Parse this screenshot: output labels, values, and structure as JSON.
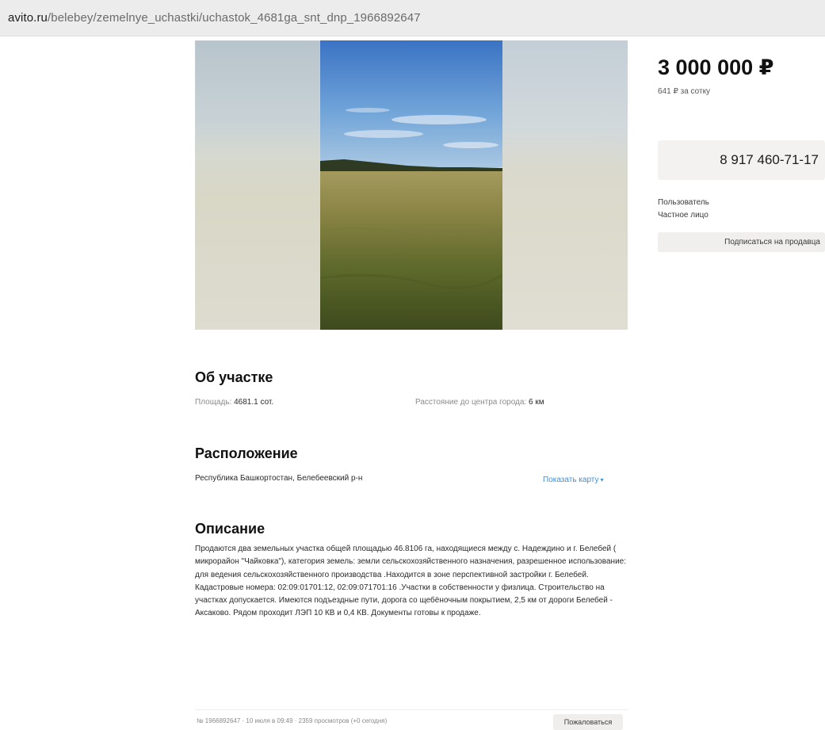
{
  "browser": {
    "url_domain": "avito.ru",
    "url_path": "/belebey/zemelnye_uchastki/uchastok_4681ga_snt_dnp_1966892647"
  },
  "listing": {
    "price": "3 000 000 ₽",
    "price_per_sotka": "641 ₽ за сотку",
    "phone": "8 917 460-71-17",
    "seller_role": "Пользователь",
    "seller_type": "Частное лицо",
    "subscribe_label": "Подписаться на продавца"
  },
  "about": {
    "title": "Об участке",
    "area_label": "Площадь:",
    "area_value": "4681.1 сот.",
    "distance_label": "Расстояние до центра города:",
    "distance_value": "6 км"
  },
  "location": {
    "title": "Расположение",
    "address": "Республика Башкортостан, Белебеевский р-н",
    "show_map_label": "Показать карту"
  },
  "description": {
    "title": "Описание",
    "text": "Продаются два земельных участка общей площадью 46.8106 га, находящиеся между с. Надеждино и г. Белебей ( микрорайон \"Чайковка\"), категория земель: земли сельскохозяйственного назначения, разрешенное использование: для ведения сельскохозяйственного производства .Находится в зоне перспективной застройки г. Белебей. Кадастровые номера: 02:09:01701:12, 02:09:071701:16 .Участки в собственности у физлица. Строительство на участках допускается. Имеются подъездные пути, дорога со щебёночным покрытием, 2,5 км от дороги Белебей - Аксаково. Рядом проходит ЛЭП 10 КВ и 0,4 КВ. Документы готовы к продаже."
  },
  "footer": {
    "meta": "№ 1966892647 · 10 июля в 09:49 · 2359 просмотров (+0 сегодня)",
    "report_label": "Пожаловаться"
  },
  "icons": {
    "map_toggle": "chevron-down-icon"
  },
  "colors": {
    "link": "#3f8fd8",
    "panel_bg": "#f3f2f0"
  }
}
